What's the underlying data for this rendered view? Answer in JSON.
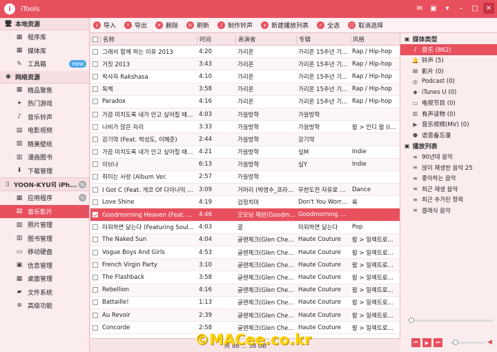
{
  "app": {
    "title": "iTools"
  },
  "sidebar": {
    "local_header": "本地资源",
    "local_items": [
      {
        "label": "程序库",
        "icon": "grid-icon"
      },
      {
        "label": "媒体库",
        "icon": "grid-icon"
      },
      {
        "label": "工具箱",
        "icon": "wrench-icon",
        "badge": "new"
      }
    ],
    "network_header": "网络资源",
    "network_items": [
      {
        "label": "精品聚焦",
        "icon": "grid-icon"
      },
      {
        "label": "热门游戏",
        "icon": "gamepad-icon"
      },
      {
        "label": "音乐铃声",
        "icon": "music-icon"
      },
      {
        "label": "电影视频",
        "icon": "film-icon"
      },
      {
        "label": "精美壁纸",
        "icon": "image-icon"
      },
      {
        "label": "漫画图书",
        "icon": "book-icon"
      },
      {
        "label": "下载管理",
        "icon": "download-icon"
      }
    ],
    "device_name": "YOON-KYU의 iPh...",
    "device_items": [
      {
        "label": "应用程序",
        "icon": "grid-icon"
      },
      {
        "label": "音乐影片",
        "icon": "film-icon",
        "active": true
      },
      {
        "label": "照片管理",
        "icon": "photo-icon"
      },
      {
        "label": "图书管理",
        "icon": "book-icon"
      },
      {
        "label": "移动硬盘",
        "icon": "drive-icon"
      },
      {
        "label": "信息管理",
        "icon": "info-icon"
      },
      {
        "label": "桌面管理",
        "icon": "desktop-icon"
      },
      {
        "label": "文件系统",
        "icon": "folder-icon"
      },
      {
        "label": "高级功能",
        "icon": "gear-icon"
      }
    ]
  },
  "toolbar": {
    "import": "导入",
    "export": "导出",
    "delete": "删除",
    "refresh": "刷新",
    "ringtone": "制作铃声",
    "new_playlist": "新建播放列表",
    "select_all": "全选",
    "deselect": "取消选择"
  },
  "table": {
    "headers": {
      "name": "名称",
      "time": "时间",
      "artist": "表演者",
      "album": "专辑",
      "genre": "风格"
    },
    "rows": [
      {
        "name": "그래서 함께 하는 이유 2013",
        "time": "4:20",
        "artist": "가리온",
        "album": "가리온 15주년 기...",
        "genre": "Rap / Hip-hop"
      },
      {
        "name": "거짓 2013",
        "time": "3:43",
        "artist": "가리온",
        "album": "가리온 15주년 기...",
        "genre": "Rap / Hip-hop"
      },
      {
        "name": "락사자 Rakshasa",
        "time": "4:10",
        "artist": "가리온",
        "album": "가리온 15주년 기...",
        "genre": "Rap / Hip-hop"
      },
      {
        "name": "독백",
        "time": "3:58",
        "artist": "가리온",
        "album": "가리온 15주년 기...",
        "genre": "Rap / Hip-hop"
      },
      {
        "name": "Paradox",
        "time": "4:16",
        "artist": "가리온",
        "album": "가리온 15주년 기...",
        "genre": "Rap / Hip-hop"
      },
      {
        "name": "가끔 미치도록 네가 안고 싶어질 때가...",
        "time": "4:03",
        "artist": "가을방학",
        "album": "가을방학",
        "genre": ""
      },
      {
        "name": "나비가 앉은 자리",
        "time": "3:33",
        "artist": "가을방학",
        "album": "가을방학",
        "genre": "팝 > 인디 팝 (In..."
      },
      {
        "name": "강기약 (Feat. 박성도, 이혜준)",
        "time": "2:44",
        "artist": "가을방학",
        "album": "강기약",
        "genre": ""
      },
      {
        "name": "가끔 미치도록 네가 안고 싶어질 때가...",
        "time": "4:21",
        "artist": "가을방학",
        "album": "실M",
        "genre": "Indie"
      },
      {
        "name": "이브나",
        "time": "6:13",
        "artist": "가을방학",
        "album": "실Y",
        "genre": "Indie"
      },
      {
        "name": "취미는 사랑 (Album Ver.",
        "time": "2:57",
        "artist": "가을방학",
        "album": "",
        "genre": ""
      },
      {
        "name": "I Got C (Feat. 개코 Of 다이나믹 듀오)",
        "time": "3:09",
        "artist": "거머리 (박명수_프라...",
        "album": "무한도전 자유로 가...",
        "genre": "Dance"
      },
      {
        "name": "Love Shine",
        "time": "4:19",
        "artist": "검정치마",
        "album": "Don't You Worry ...",
        "genre": "록"
      },
      {
        "name": "Goodmorning Heaven (Feat. 하림)",
        "time": "4:46",
        "artist": "굿모닝 헤븐(Goodm...",
        "album": "Goodmorning He...",
        "genre": "",
        "selected": true
      },
      {
        "name": "미워하면 닮는다 (Featuring Soulm...",
        "time": "4:03",
        "artist": "굴",
        "album": "미워하면 닮는다",
        "genre": "Pop"
      },
      {
        "name": "The Naked Sun",
        "time": "4:04",
        "artist": "글렌체크(Glen Check)",
        "album": "Haute Couture",
        "genre": "팝 > 일렉트로..."
      },
      {
        "name": "Vogue Boys And Girls",
        "time": "4:53",
        "artist": "글렌체크(Glen Check)",
        "album": "Haute Couture",
        "genre": "팝 > 일렉트로..."
      },
      {
        "name": "French Virgin Party",
        "time": "3:10",
        "artist": "글렌체크(Glen Check)",
        "album": "Haute Couture",
        "genre": "팝 > 일렉트로..."
      },
      {
        "name": "The Flashback",
        "time": "3:58",
        "artist": "글렌체크(Glen Check)",
        "album": "Haute Couture",
        "genre": "팝 > 일렉트로..."
      },
      {
        "name": "Rebellion",
        "time": "4:16",
        "artist": "글렌체크(Glen Check)",
        "album": "Haute Couture",
        "genre": "팝 > 일렉트로..."
      },
      {
        "name": "Battaille!",
        "time": "1:13",
        "artist": "글렌체크(Glen Check)",
        "album": "Haute Couture",
        "genre": "팝 > 일렉트로..."
      },
      {
        "name": "Au Revoir",
        "time": "2:39",
        "artist": "글렌체크(Glen Check)",
        "album": "Haute Couture",
        "genre": "팝 > 일렉트로..."
      },
      {
        "name": "Concorde",
        "time": "2:58",
        "artist": "글렌체크(Glen Check)",
        "album": "Haute Couture",
        "genre": "팝 > 일렉트로..."
      }
    ]
  },
  "status": {
    "text": "共 86 ... 58 GB"
  },
  "media_panel": {
    "types_header": "媒体类型",
    "types": [
      {
        "label": "音乐 (862)",
        "icon": "music-icon",
        "active": true
      },
      {
        "label": "铃声 (5)",
        "icon": "bell-icon"
      },
      {
        "label": "影片 (0)",
        "icon": "film-icon"
      },
      {
        "label": "Podcast (0)",
        "icon": "podcast-icon"
      },
      {
        "label": "iTunes U (0)",
        "icon": "graduation-icon"
      },
      {
        "label": "电视节目 (0)",
        "icon": "tv-icon"
      },
      {
        "label": "有声读物 (0)",
        "icon": "audiobook-icon"
      },
      {
        "label": "音乐视频(MV) (0)",
        "icon": "mv-icon"
      },
      {
        "label": "语音备忘录",
        "icon": "mic-icon"
      }
    ],
    "playlist_header": "播放列表",
    "playlists": [
      "90년대 음악",
      "많이 재생한 음악 25",
      "좋아하는 음악",
      "최근 재생 음악",
      "최근 추가된 항목",
      "클래식 음악"
    ]
  },
  "watermark": "©MACee.co.kr",
  "colors": {
    "accent": "#e8505e",
    "background": "#f9e3e6"
  }
}
